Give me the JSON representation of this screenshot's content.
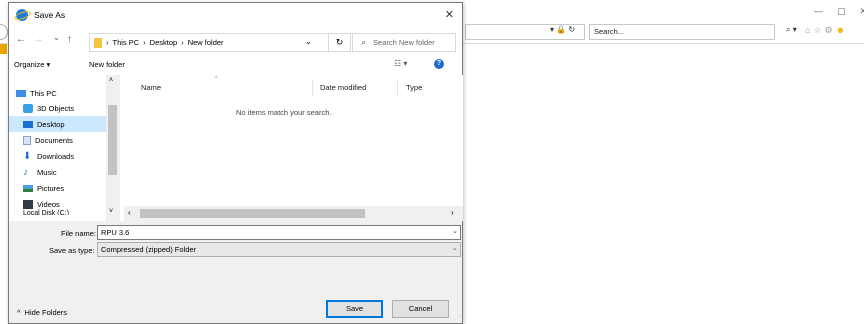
{
  "browser": {
    "search_placeholder": "Search...",
    "addr_icons": "▾ 🔒 ↻",
    "search_dropdown": "⌕ ▾",
    "win_min": "—",
    "win_restore": "▢",
    "win_close": "✕",
    "tool_home": "⌂",
    "tool_star": "☆",
    "tool_gear": "⚙",
    "tool_smiley": "☻"
  },
  "dialog": {
    "title": "Save As",
    "close_glyph": "✕",
    "nav": {
      "back": "←",
      "forward": "→",
      "recent": "⌄",
      "up": "↑",
      "breadcrumb": [
        "This PC",
        "Desktop",
        "New folder"
      ],
      "breadcrumb_sep": "›",
      "dropdown": "⌄",
      "refresh": "↻",
      "search_placeholder": "Search New folder"
    },
    "command_bar": {
      "organize": "Organize ▾",
      "new_folder": "New folder",
      "view": "☷ ▾",
      "help": "?"
    },
    "nav_pane": {
      "items": [
        {
          "label": "This PC",
          "icon": "computer-icon",
          "color": "#3a8ee6"
        },
        {
          "label": "3D Objects",
          "icon": "cube-icon",
          "color": "#38a0e8"
        },
        {
          "label": "Desktop",
          "icon": "desktop-icon",
          "color": "#1a6fd0",
          "selected": true
        },
        {
          "label": "Documents",
          "icon": "document-icon",
          "color": "#8aa4c8"
        },
        {
          "label": "Downloads",
          "icon": "download-arrow-icon",
          "color": "#1f6fd8"
        },
        {
          "label": "Music",
          "icon": "music-note-icon",
          "color": "#2a6ad6"
        },
        {
          "label": "Pictures",
          "icon": "pictures-icon",
          "color": "#4aa0e0"
        },
        {
          "label": "Videos",
          "icon": "video-icon",
          "color": "#333a44"
        }
      ],
      "cut_item": "Local Disk (C:)",
      "scroll_up": "˄",
      "scroll_down": "˅"
    },
    "file_list": {
      "columns": [
        "Name",
        "Date modified",
        "Type"
      ],
      "sort_caret": "^",
      "empty_message": "No items match your search.",
      "scroll_left": "‹",
      "scroll_right": "›"
    },
    "file_name": {
      "label": "File name:",
      "value": "RPU 3.6",
      "dropdown": "⌄"
    },
    "save_as_type": {
      "label": "Save as type:",
      "value": "Compressed (zipped) Folder",
      "dropdown": "⌄"
    },
    "hide_folders": {
      "glyph": "^",
      "label": "Hide Folders"
    },
    "buttons": {
      "save": "Save",
      "cancel": "Cancel"
    },
    "accent_color": "#0078d7",
    "selection_color": "#cce8ff"
  }
}
